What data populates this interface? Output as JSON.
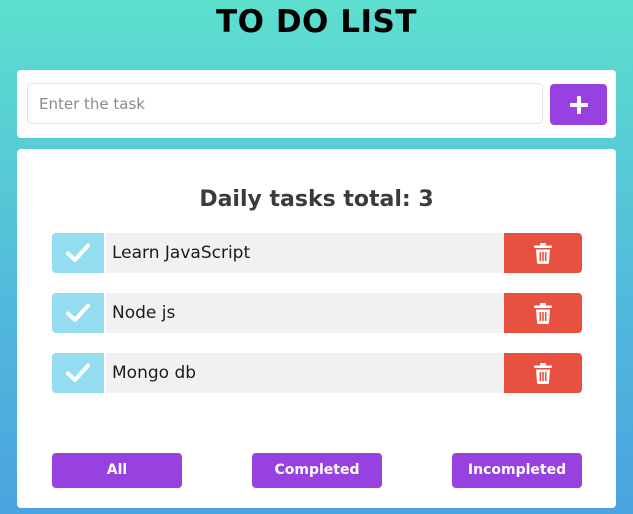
{
  "header": {
    "title": "TO DO LIST"
  },
  "input_area": {
    "placeholder": "Enter the task",
    "value": "",
    "add_icon": "plus-icon"
  },
  "tasks_panel": {
    "heading": "Daily tasks total: 3",
    "tasks": [
      {
        "label": "Learn JavaScript",
        "check_icon": "check-icon",
        "delete_icon": "trash-icon"
      },
      {
        "label": "Node js",
        "check_icon": "check-icon",
        "delete_icon": "trash-icon"
      },
      {
        "label": "Mongo db",
        "check_icon": "check-icon",
        "delete_icon": "trash-icon"
      }
    ]
  },
  "filters": [
    {
      "label": "All"
    },
    {
      "label": "Completed"
    },
    {
      "label": "Incompleted"
    }
  ],
  "colors": {
    "accent_purple": "#9741e0",
    "check_blue": "#94dcf0",
    "delete_red": "#e8513f",
    "task_bg": "#f1f1f1",
    "background_top": "#5ddfce",
    "background_bottom": "#4aa3df"
  }
}
